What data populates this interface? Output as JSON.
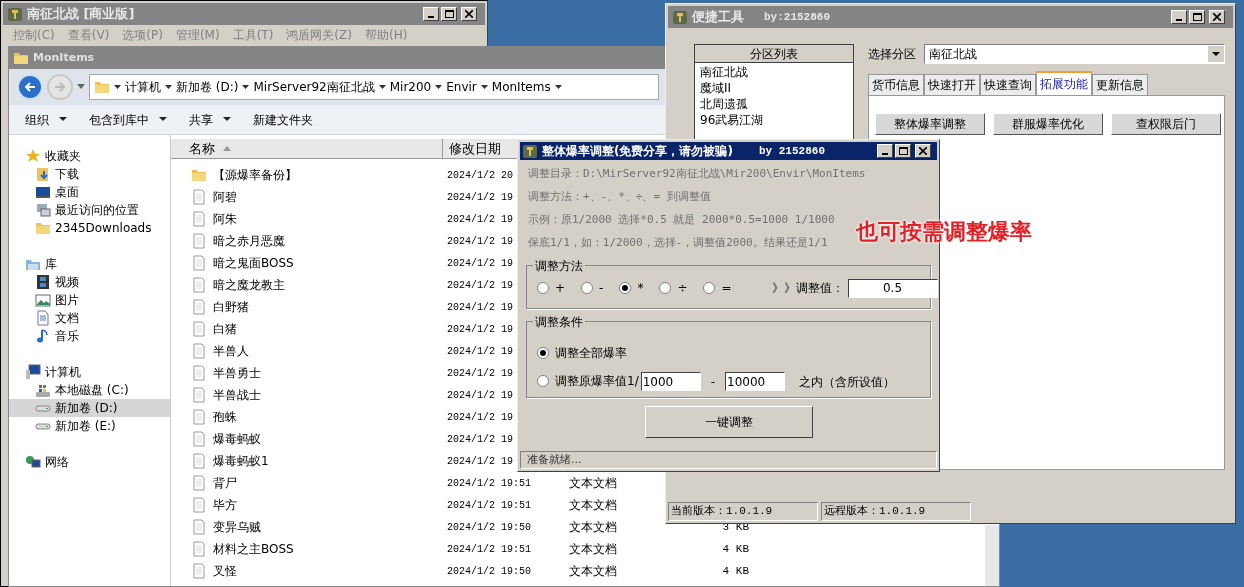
{
  "main_window": {
    "title": "南征北战 [商业版]",
    "menu": [
      "控制(C)",
      "查看(V)",
      "选项(P)",
      "管理(M)",
      "工具(T)",
      "鸿盾网关(Z)",
      "帮助(H)"
    ]
  },
  "explorer": {
    "title": "MonItems",
    "breadcrumb": [
      "计算机",
      "新加卷 (D:)",
      "MirServer92南征北战",
      "Mir200",
      "Envir",
      "MonItems"
    ],
    "toolbar": [
      {
        "label": "组织",
        "dropdown": true
      },
      {
        "label": "包含到库中",
        "dropdown": true
      },
      {
        "label": "共享",
        "dropdown": true
      },
      {
        "label": "新建文件夹",
        "dropdown": false
      }
    ],
    "sidebar": [
      {
        "label": "收藏夹",
        "kind": "favorites",
        "selected": false,
        "children": [
          {
            "label": "下载",
            "kind": "downloads",
            "selected": false
          },
          {
            "label": "桌面",
            "kind": "desktop",
            "selected": false
          },
          {
            "label": "最近访问的位置",
            "kind": "recent",
            "selected": false
          },
          {
            "label": "2345Downloads",
            "kind": "folder",
            "selected": false
          }
        ]
      },
      {
        "label": "库",
        "kind": "libraries",
        "selected": false,
        "children": [
          {
            "label": "视频",
            "kind": "videos",
            "selected": false
          },
          {
            "label": "图片",
            "kind": "pictures",
            "selected": false
          },
          {
            "label": "文档",
            "kind": "documents",
            "selected": false
          },
          {
            "label": "音乐",
            "kind": "music",
            "selected": false
          }
        ]
      },
      {
        "label": "计算机",
        "kind": "computer",
        "selected": false,
        "children": [
          {
            "label": "本地磁盘 (C:)",
            "kind": "system-drive",
            "selected": false
          },
          {
            "label": "新加卷 (D:)",
            "kind": "drive",
            "selected": true
          },
          {
            "label": "新加卷 (E:)",
            "kind": "drive",
            "selected": false
          }
        ]
      },
      {
        "label": "网络",
        "kind": "network",
        "selected": false
      }
    ],
    "columns": [
      {
        "label": "名称",
        "sorted": true
      },
      {
        "label": "修改日期",
        "sorted": false
      }
    ],
    "files": [
      {
        "name": "【源爆率备份】",
        "kind": "folder",
        "modified": "2024/1/2 20"
      },
      {
        "name": "阿碧",
        "kind": "file",
        "modified": "2024/1/2 19"
      },
      {
        "name": "阿朱",
        "kind": "file",
        "modified": "2024/1/2 19"
      },
      {
        "name": "暗之赤月恶魔",
        "kind": "file",
        "modified": "2024/1/2 19"
      },
      {
        "name": "暗之鬼面BOSS",
        "kind": "file",
        "modified": "2024/1/2 19"
      },
      {
        "name": "暗之魔龙教主",
        "kind": "file",
        "modified": "2024/1/2 19"
      },
      {
        "name": "白野猪",
        "kind": "file",
        "modified": "2024/1/2 19"
      },
      {
        "name": "白猪",
        "kind": "file",
        "modified": "2024/1/2 19"
      },
      {
        "name": "半兽人",
        "kind": "file",
        "modified": "2024/1/2 19"
      },
      {
        "name": "半兽勇士",
        "kind": "file",
        "modified": "2024/1/2 19"
      },
      {
        "name": "半兽战士",
        "kind": "file",
        "modified": "2024/1/2 19"
      },
      {
        "name": "孢蛛",
        "kind": "file",
        "modified": "2024/1/2 19"
      },
      {
        "name": "爆毒蚂蚁",
        "kind": "file",
        "modified": "2024/1/2 19"
      },
      {
        "name": "爆毒蚂蚁1",
        "kind": "file",
        "modified": "2024/1/2 19"
      },
      {
        "name": "背尸",
        "kind": "file",
        "modified": "2024/1/2 19:51",
        "type": "文本文档"
      },
      {
        "name": "毕方",
        "kind": "file",
        "modified": "2024/1/2 19:51",
        "type": "文本文档"
      },
      {
        "name": "变异乌贼",
        "kind": "file",
        "modified": "2024/1/2 19:50",
        "type": "文本文档",
        "size": "3 KB"
      },
      {
        "name": "材料之主BOSS",
        "kind": "file",
        "modified": "2024/1/2 19:51",
        "type": "文本文档",
        "size": "4 KB"
      },
      {
        "name": "叉怪",
        "kind": "file",
        "modified": "2024/1/2 19:50",
        "type": "文本文档",
        "size": "4 KB"
      }
    ]
  },
  "quick_tool": {
    "title": "便捷工具",
    "author": "by:2152860",
    "partition_list": {
      "header": "分区列表",
      "items": [
        "南征北战",
        "魔域II",
        "北周遗孤",
        "96武易江湖"
      ]
    },
    "select_label": "选择分区",
    "select_value": "南征北战",
    "tabs": [
      {
        "label": "货币信息",
        "selected": false
      },
      {
        "label": "快速打开",
        "selected": false
      },
      {
        "label": "快速查询",
        "selected": false
      },
      {
        "label": "拓展功能",
        "selected": true
      },
      {
        "label": "更新信息",
        "selected": false
      }
    ],
    "buttons": [
      "整体爆率调整",
      "群服爆率优化",
      "查权限后门"
    ],
    "status": [
      "当前版本：1.0.1.9",
      "远程版本：1.0.1.9"
    ]
  },
  "dialog": {
    "title": "整体爆率调整(免费分享，请勿被骗)",
    "author": "by 2152860",
    "info": [
      "调整目录：D:\\MirServer92南征北战\\Mir200\\Envir\\MonItems",
      "调整方法：+、-、*、÷、=  到调整值",
      "示例：原1/2000 选择*0.5 就是 2000*0.5=1000  1/1000",
      "保底1/1，如：1/2000，选择-，调整值2000。结果还是1/1"
    ],
    "method": {
      "title": "调整方法",
      "options": [
        {
          "label": "+",
          "selected": false
        },
        {
          "label": "-",
          "selected": false
        },
        {
          "label": "*",
          "selected": true
        },
        {
          "label": "÷",
          "selected": false
        },
        {
          "label": "=",
          "selected": false
        }
      ],
      "value_label": "》》调整值：",
      "value": "0.5"
    },
    "condition": {
      "title": "调整条件",
      "options": [
        {
          "label": "调整全部爆率",
          "selected": true
        },
        {
          "label": "调整原爆率值1/",
          "selected": false
        }
      ],
      "from": "1000",
      "dash": "-",
      "to": "10000",
      "suffix": "之内（含所设值）"
    },
    "button": "一键调整",
    "status": "准备就绪..."
  },
  "annotation": "也可按需调整爆率"
}
